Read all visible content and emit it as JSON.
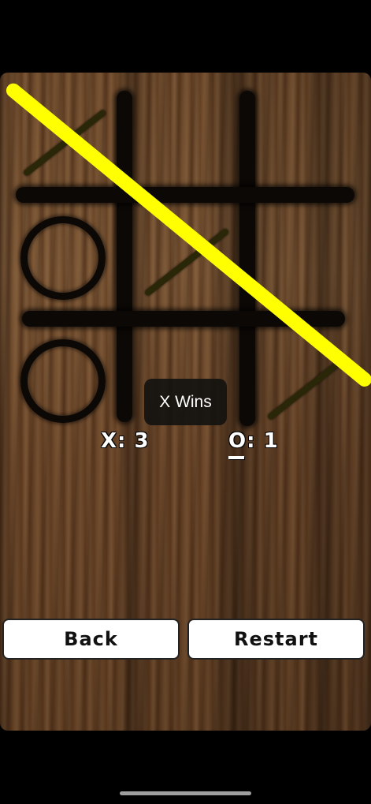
{
  "game": {
    "board": [
      [
        "X",
        "",
        ""
      ],
      [
        "O",
        "X",
        ""
      ],
      [
        "O",
        "",
        "X"
      ]
    ],
    "winning_line": "diagonal-top-left-to-bottom-right",
    "win_line_color": "#ffff00",
    "mark_color_x": "#2a2608",
    "mark_color_o": "#0b0806"
  },
  "toast": {
    "message": "X Wins"
  },
  "score": {
    "x_label": "X:",
    "x_value": "3",
    "o_label": "O:",
    "o_value": "1",
    "underlined_player": "O"
  },
  "buttons": {
    "back_label": "Back",
    "restart_label": "Restart"
  }
}
